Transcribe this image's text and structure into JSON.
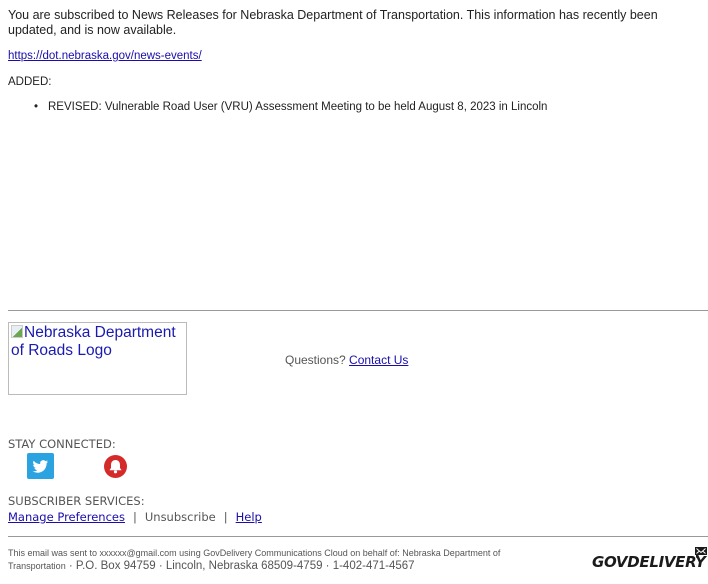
{
  "intro_text": "You are subscribed to News Releases for Nebraska Department of Transportation. This information has recently been updated, and is now available.",
  "news_link": "https://dot.nebraska.gov/news-events/",
  "added_label": "ADDED:",
  "items": [
    {
      "text": "REVISED: Vulnerable Road User (VRU) Assessment Meeting to be held August 8, 2023 in Lincoln"
    }
  ],
  "logo_alt": "Nebraska Department of Roads Logo",
  "questions": {
    "label": "Questions?",
    "link": "Contact Us"
  },
  "stay_connected": {
    "label": "STAY CONNECTED:",
    "icons": [
      {
        "name": "twitter-icon",
        "color": "#2aa3e0"
      },
      {
        "name": "bell-icon",
        "color": "#d42a2a"
      }
    ]
  },
  "subscriber_services": {
    "label": "SUBSCRIBER SERVICES:",
    "manage": "Manage Preferences",
    "separator": "|",
    "unsubscribe": "Unsubscribe",
    "help": "Help"
  },
  "footer": {
    "line1": "This email was sent to xxxxxx@gmail.com using GovDelivery Communications Cloud on behalf of: Nebraska Department of",
    "line2_small": "Transportation",
    "line2_big": " · P.O. Box 94759 · Lincoln, Nebraska 68509-4759 · 1-402-471-4567",
    "brand": "GOVDELIVERY"
  }
}
